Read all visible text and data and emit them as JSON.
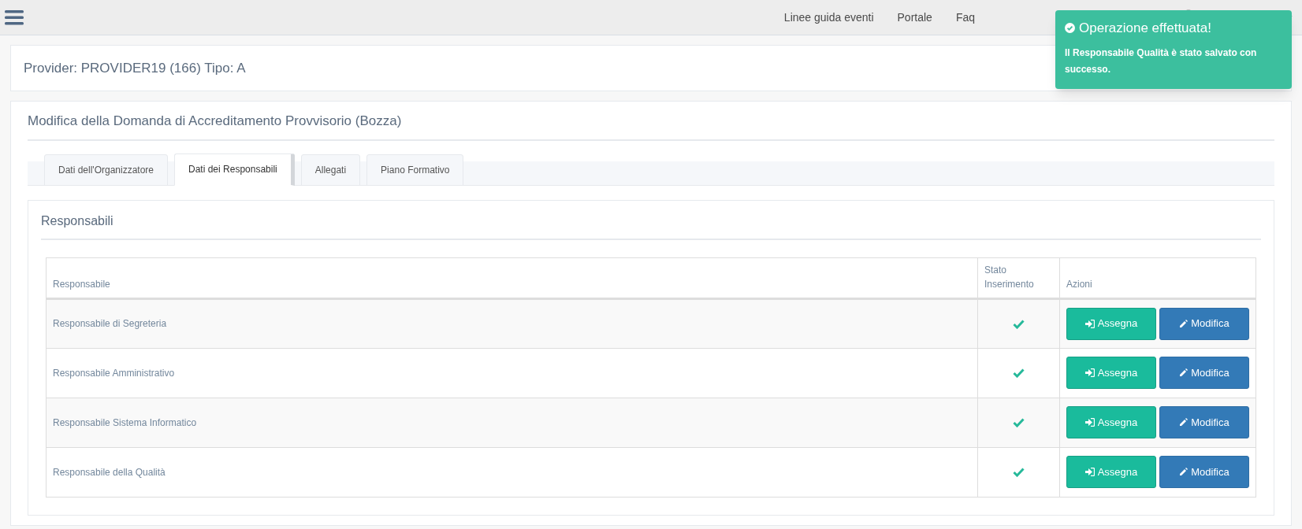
{
  "topbar": {
    "nav_links": [
      "Linee guida eventi",
      "Portale",
      "Faq"
    ]
  },
  "provider_card": {
    "title": "Provider: PROVIDER19 (166) Tipo: A"
  },
  "toast": {
    "title": "Operazione effettuata!",
    "message": "Il Responsabile Qualità è stato salvato con successo."
  },
  "main": {
    "title": "Modifica della Domanda di Accreditamento Provvisorio (Bozza)",
    "tabs": [
      {
        "label": "Dati dell'Organizzatore",
        "selected": false
      },
      {
        "label": "Dati dei Responsabili",
        "selected": true
      },
      {
        "label": "Allegati",
        "selected": false
      },
      {
        "label": "Piano Formativo",
        "selected": false
      }
    ],
    "panel_title": "Responsabili",
    "table": {
      "columns": [
        "Responsabile",
        "Stato Inserimento",
        "Azioni"
      ],
      "rows": [
        {
          "name": "Responsabile di Segreteria",
          "inserted": true,
          "actions": [
            "Assegna",
            "Modifica"
          ]
        },
        {
          "name": "Responsabile Amministrativo",
          "inserted": true,
          "actions": [
            "Assegna",
            "Modifica"
          ]
        },
        {
          "name": "Responsabile Sistema Informatico",
          "inserted": true,
          "actions": [
            "Assegna",
            "Modifica"
          ]
        },
        {
          "name": "Responsabile della Qualità",
          "inserted": true,
          "actions": [
            "Assegna",
            "Modifica"
          ]
        }
      ]
    }
  }
}
